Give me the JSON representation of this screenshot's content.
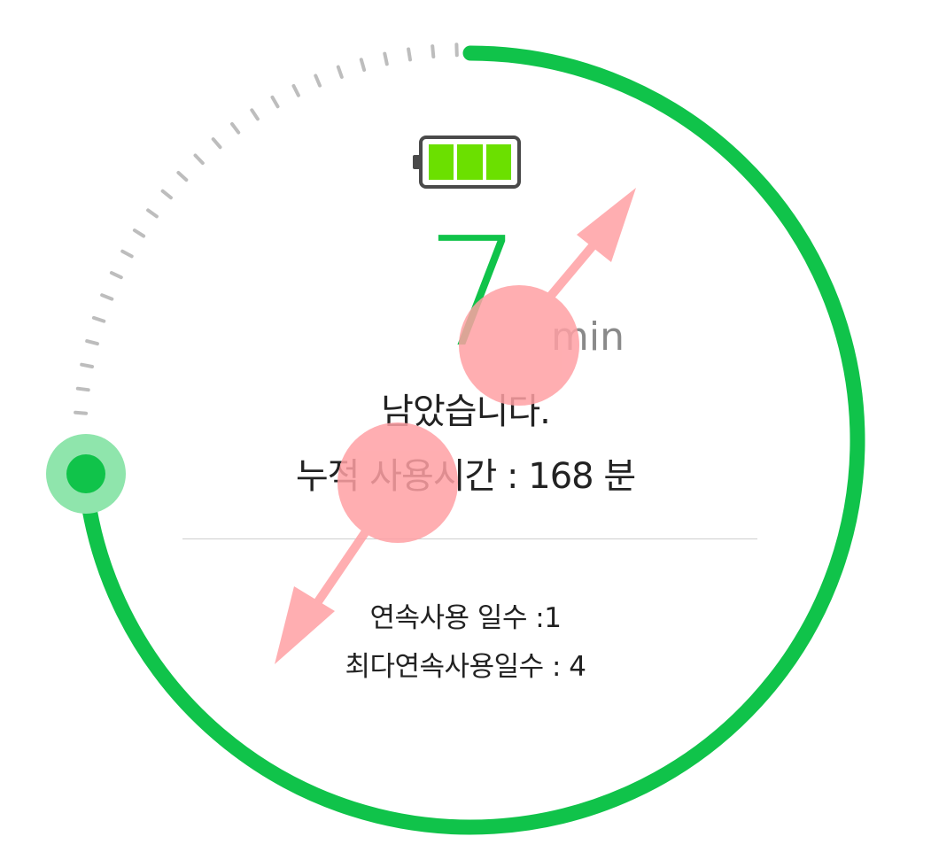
{
  "timer": {
    "remaining_value": "7",
    "remaining_unit": "min",
    "remaining_label": "남았습니다.",
    "cumulative_label": "누적 사용시간 :",
    "cumulative_value": "168",
    "cumulative_unit": "분",
    "streak_label": "연속사용 일수 :",
    "streak_value": "1",
    "max_streak_label": "최다연속사용일수 :",
    "max_streak_value": "4",
    "battery_level": 1.0
  },
  "colors": {
    "progress_green": "#10c34a",
    "handle_outer": "#8fe5ac",
    "battery_fill": "#6be000",
    "battery_outline": "#4a4a4a",
    "tick_gray": "#bdbdbd",
    "gesture_overlay": "#ffa0a4"
  },
  "icons": {
    "battery": "battery-full-icon",
    "gesture": "pinch-zoom-gesture-icon"
  }
}
